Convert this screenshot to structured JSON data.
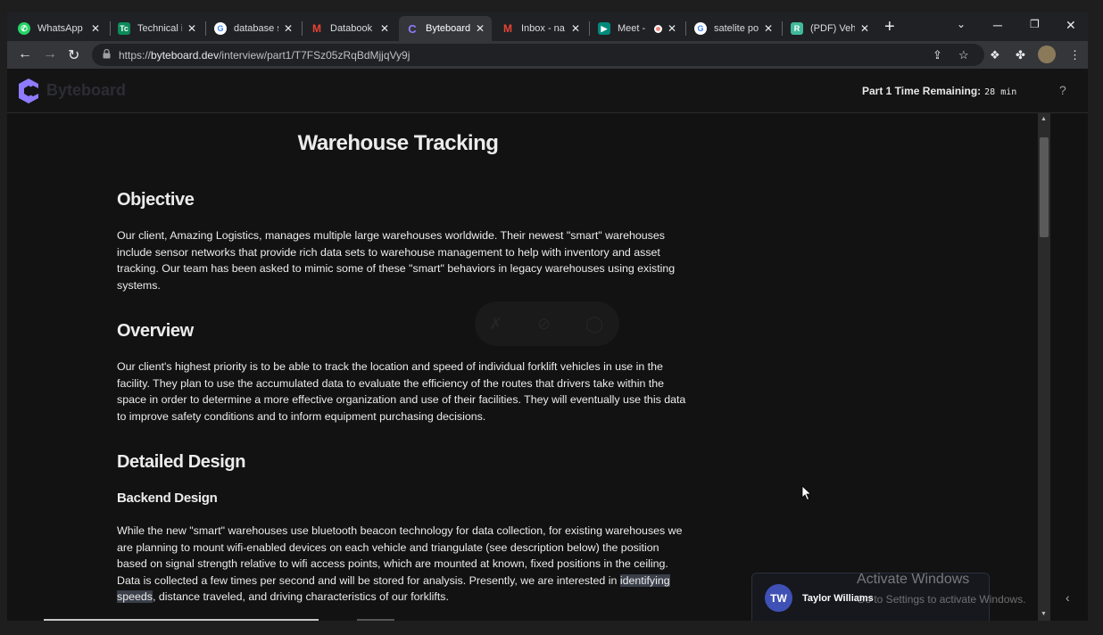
{
  "browser": {
    "tabs": [
      {
        "title": "WhatsApp",
        "icon": "whatsapp-icon",
        "color": "#25d366",
        "active": false
      },
      {
        "title": "Technical i",
        "icon": "tc-icon",
        "color": "#0b8a5a",
        "active": false
      },
      {
        "title": "database s",
        "icon": "google-icon",
        "color": "#ffffff",
        "active": false
      },
      {
        "title": "Databook",
        "icon": "gmail-icon",
        "color": "#ea4335",
        "active": false
      },
      {
        "title": "Byteboard",
        "icon": "byteboard-icon",
        "color": "#7b61ff",
        "active": true
      },
      {
        "title": "Inbox - na",
        "icon": "gmail-icon",
        "color": "#ea4335",
        "active": false
      },
      {
        "title": "Meet - ",
        "icon": "meet-icon",
        "color": "#00897b",
        "active": false
      },
      {
        "title": "satelite po",
        "icon": "google-icon",
        "color": "#ffffff",
        "active": false
      },
      {
        "title": "(PDF) Vehi",
        "icon": "researchgate-icon",
        "color": "#40ba9b",
        "active": false
      }
    ],
    "url_prefix": "https://",
    "url_host": "byteboard.dev",
    "url_path": "/interview/part1/T7FSz05zRqBdMjjqVy9j"
  },
  "app": {
    "brand": "Byteboard",
    "timer_label": "Part 1 Time Remaining:",
    "timer_value": "28 min",
    "help": "?"
  },
  "doc": {
    "title": "Warehouse Tracking",
    "objective_heading": "Objective",
    "objective_text": "Our client, Amazing Logistics, manages multiple large warehouses worldwide. Their newest \"smart\" warehouses include sensor networks that provide rich data sets to warehouse management to help with inventory and asset tracking. Our team has been asked to mimic some of these \"smart\" behaviors in legacy warehouses using existing systems.",
    "overview_heading": "Overview",
    "overview_text": "Our client's highest priority is to be able to track the location and speed of individual forklift vehicles in use in the facility. They plan to use the accumulated data to evaluate the efficiency of the routes that drivers take within the space in order to determine a more effective organization and use of their facilities. They will eventually use this data to improve safety conditions and to inform equipment purchasing decisions.",
    "detailed_heading": "Detailed Design",
    "backend_heading": "Backend Design",
    "backend_text_before": "While the new \"smart\" warehouses use bluetooth beacon technology for data collection, for existing warehouses we are planning to mount wifi-enabled devices on each vehicle and triangulate (see description below) the position based on signal strength relative to wifi access points, which are mounted at known, fixed positions in the ceiling. Data is collected a few times per second and will be stored for analysis. Presently, we are interested in ",
    "backend_text_highlight": "identifying speeds",
    "backend_text_after": ", distance traveled, and driving characteristics of our forklifts."
  },
  "overlay": {
    "activate_title": "Activate Windows",
    "activate_sub": "Go to Settings to activate Windows.",
    "participant_initials": "TW",
    "participant_name": "Taylor Williams"
  }
}
